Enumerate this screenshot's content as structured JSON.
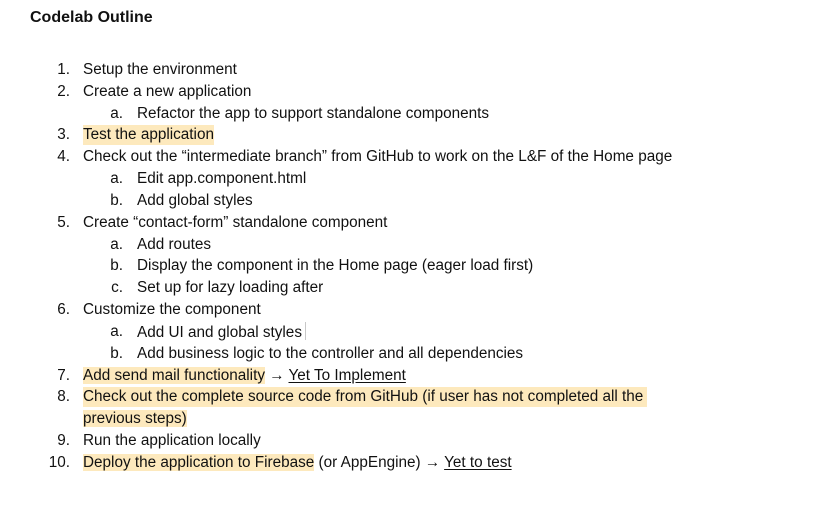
{
  "document": {
    "title": "Codelab Outline",
    "items": [
      {
        "number": "1.",
        "text": "Setup the environment"
      },
      {
        "number": "2.",
        "text": "Create a new application",
        "subitems": [
          {
            "letter": "a.",
            "text": "Refactor the app to support standalone components"
          }
        ]
      },
      {
        "number": "3.",
        "text": "Test the application"
      },
      {
        "number": "4.",
        "text": "Check out the “intermediate branch” from GitHub to work on the L&F of the Home page",
        "subitems": [
          {
            "letter": "a.",
            "text": "Edit app.component.html"
          },
          {
            "letter": "b.",
            "text": "Add global styles"
          }
        ]
      },
      {
        "number": "5.",
        "text": "Create “contact-form” standalone component",
        "subitems": [
          {
            "letter": "a.",
            "text": "Add routes"
          },
          {
            "letter": "b.",
            "text": "Display the component in the Home page (eager load first)"
          },
          {
            "letter": "c.",
            "text": "Set up for lazy loading after"
          }
        ]
      },
      {
        "number": "6.",
        "text": "Customize the component",
        "subitems": [
          {
            "letter": "a.",
            "text": "Add UI and global styles"
          },
          {
            "letter": "b.",
            "text": "Add business logic to the controller and all dependencies"
          }
        ]
      },
      {
        "number": "7.",
        "text": "Add send mail functionality",
        "arrow": "→",
        "link": "Yet To Implement"
      },
      {
        "number": "8.",
        "text_line1": "Check out the complete source code from GitHub (if user has not completed all the",
        "text_line2": "previous steps)"
      },
      {
        "number": "9.",
        "text": "Run the application locally"
      },
      {
        "number": "10.",
        "text": "Deploy the application to Firebase",
        "rest": " (or AppEngine) ",
        "arrow": "→",
        "link": "Yet to test"
      }
    ]
  },
  "colors": {
    "highlight": "#fde9bd",
    "text": "#111111",
    "cursor": "#c8c8c8"
  }
}
